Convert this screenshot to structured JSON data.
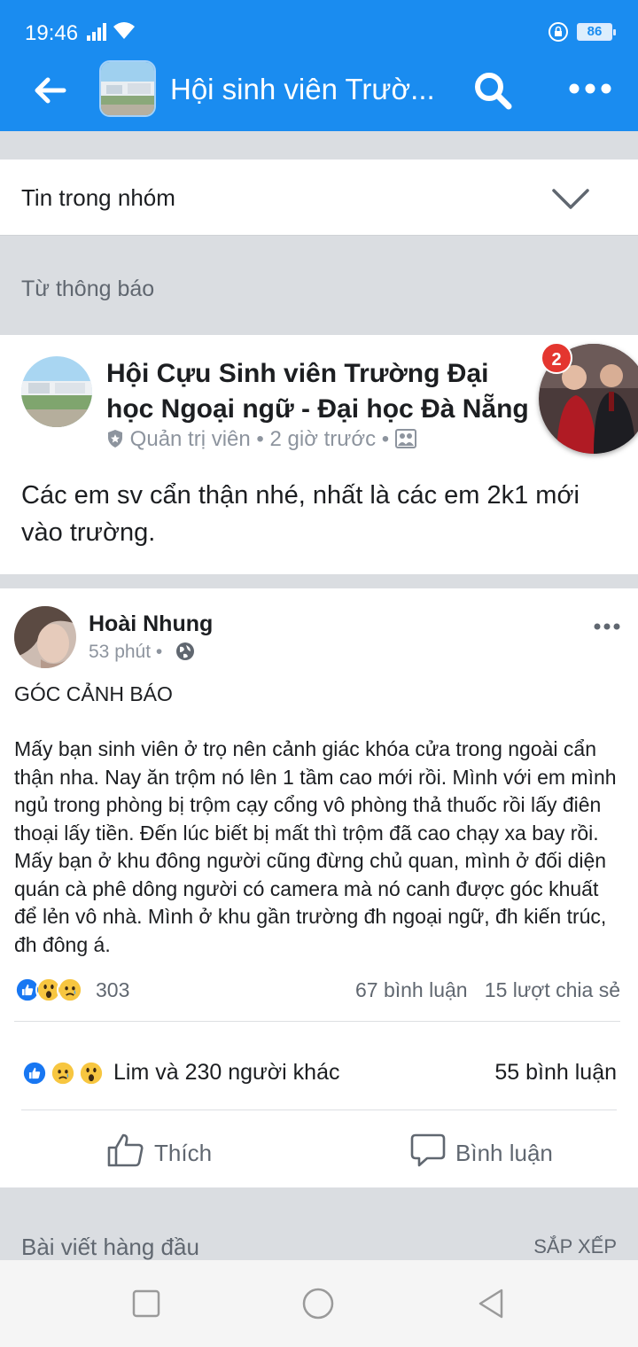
{
  "status_bar": {
    "time": "19:46",
    "battery": "86"
  },
  "app_bar": {
    "title": "Hội sinh viên Trườ...",
    "back_icon": "arrow-left-icon",
    "search_icon": "search-icon",
    "more_icon": "more-dots-icon"
  },
  "news_filter": {
    "label": "Tin trong nhóm"
  },
  "section_from": {
    "label": "Từ thông báo"
  },
  "announcement": {
    "group_name": "Hội Cựu Sinh viên Trường Đại học Ngoại ngữ - Đại học Đà Nẵng",
    "role": "Quản trị viên",
    "time": "2 giờ trước",
    "body": "Các em sv cẩn thận nhé, nhất là các em 2k1 mới vào trường."
  },
  "chat_head": {
    "badge": "2"
  },
  "post": {
    "author": "Hoài Nhung",
    "time": "53 phút",
    "heading": "GÓC CẢNH BÁO",
    "body": "Mấy bạn sinh viên ở trọ nên cảnh giác khóa cửa trong ngoài cẩn thận nha. Nay ăn trộm nó lên 1 tầm cao mới rồi. Mình với em mình ngủ trong phòng bị trộm cạy cổng vô phòng thả thuốc rồi lấy điên thoại lấy tiền. Đến lúc biết bị mất thì trộm đã cao chạy xa bay rồi. Mấy bạn ở khu đông người cũng đừng chủ quan, mình ở đối diện quán cà phê dông người có camera mà nó canh được góc khuất để lẻn vô nhà. Mình ở khu gần trường đh ngoại ngữ, đh kiến trúc, đh đông á.",
    "reaction_count": "303",
    "comments": "67 bình luận",
    "shares": "15 lượt chia sẻ"
  },
  "share_summary": {
    "reactors": "Lim và 230 người khác",
    "comments": "55 bình luận"
  },
  "actions": {
    "like": "Thích",
    "comment": "Bình luận"
  },
  "top_posts": {
    "label": "Bài viết hàng đầu",
    "sort": "SẮP XẾP"
  },
  "colors": {
    "brand": "#1a8cf0",
    "like_blue": "#1877f2",
    "badge_red": "#e4362f"
  }
}
